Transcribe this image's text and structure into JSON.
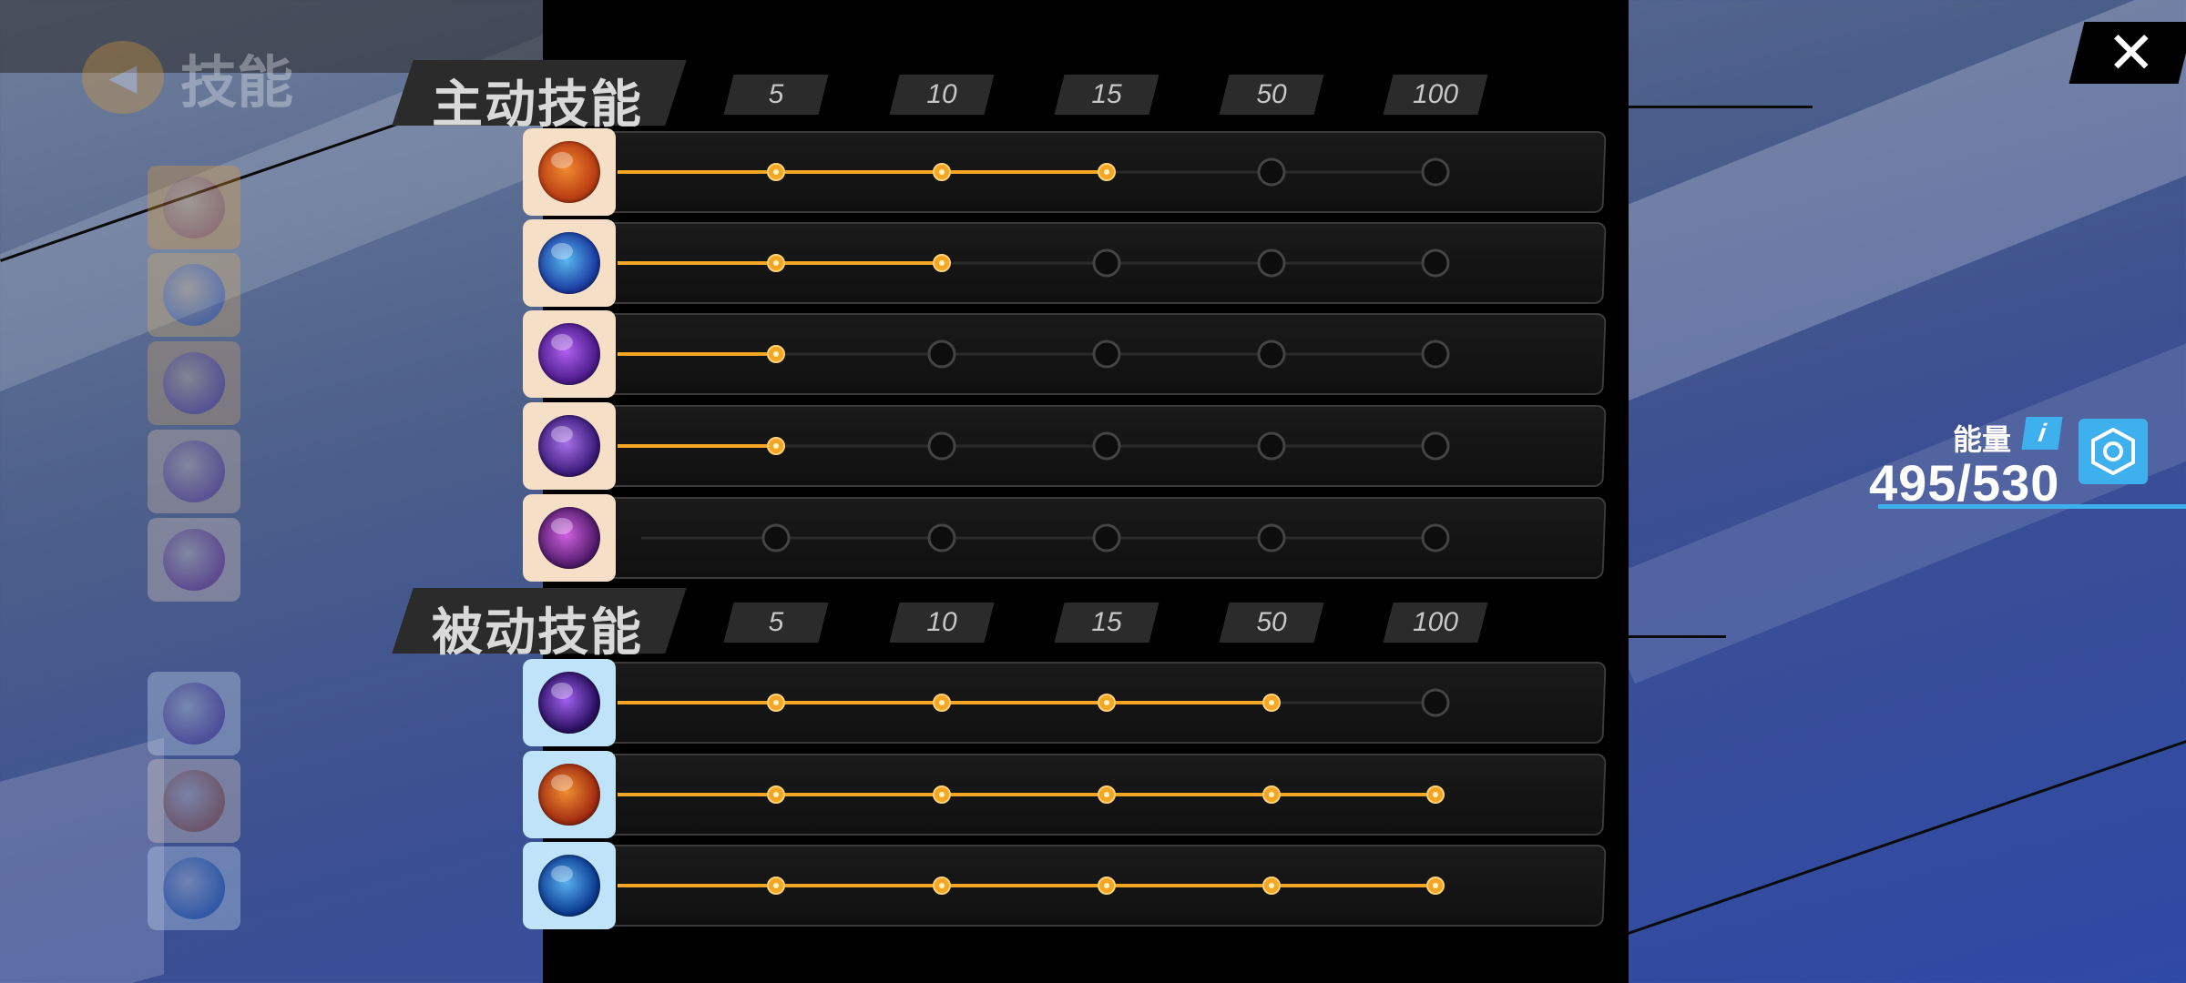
{
  "sidebar": {
    "title": "技能",
    "icons": [
      {
        "name": "fire-fist-icon",
        "color": "#e8a030",
        "orb": "#c05020"
      },
      {
        "name": "shield-icon",
        "color": "#e0b060",
        "orb": "#4060c0"
      },
      {
        "name": "burst-icon",
        "color": "#d8a868",
        "orb": "#6030a0"
      },
      {
        "name": "figure-icon",
        "color": "#e6c7a8",
        "orb": "#7a3aa8"
      },
      {
        "name": "vortex-icon",
        "color": "#f0d6c0",
        "orb": "#8a2a9a"
      },
      {
        "name": "galaxy-icon",
        "color": "#d8ecf8",
        "orb": "#6840b0"
      },
      {
        "name": "flame-swirl-icon",
        "color": "#f2dcc8",
        "orb": "#d06020"
      },
      {
        "name": "water-swirl-icon",
        "color": "#d4ecfa",
        "orb": "#2070d0"
      }
    ]
  },
  "active": {
    "title": "主动技能",
    "milestones": [
      "5",
      "10",
      "15",
      "50",
      "100"
    ],
    "skills": [
      {
        "icon": "fire-fist-icon",
        "levels_unlocked": 3,
        "orb": "#b83a12",
        "orb2": "#f08a30"
      },
      {
        "icon": "shield-icon",
        "levels_unlocked": 2,
        "orb": "#1a3aa0",
        "orb2": "#58b8f0"
      },
      {
        "icon": "burst-icon",
        "levels_unlocked": 1,
        "orb": "#4a1a8a",
        "orb2": "#b060f0"
      },
      {
        "icon": "figure-icon",
        "levels_unlocked": 1,
        "orb": "#3a1a7a",
        "orb2": "#a870e8"
      },
      {
        "icon": "vortex-icon",
        "levels_unlocked": 0,
        "orb": "#501a6a",
        "orb2": "#d060e0"
      }
    ]
  },
  "passive": {
    "title": "被动技能",
    "milestones": [
      "5",
      "10",
      "15",
      "50",
      "100"
    ],
    "skills": [
      {
        "icon": "galaxy-icon",
        "levels_unlocked": 4,
        "orb": "#2a1060",
        "orb2": "#a060f0"
      },
      {
        "icon": "flame-swirl-icon",
        "levels_unlocked": 5,
        "orb": "#a02a10",
        "orb2": "#f09030"
      },
      {
        "icon": "water-swirl-icon",
        "levels_unlocked": 5,
        "orb": "#0a3a90",
        "orb2": "#58b0f0"
      }
    ]
  },
  "energy": {
    "label": "能量",
    "info": "i",
    "value": "495/530",
    "accent": "#3fb0ee"
  },
  "close": {
    "label": "✕"
  },
  "colors": {
    "progress": "#f5a623",
    "locked": "#444444"
  }
}
